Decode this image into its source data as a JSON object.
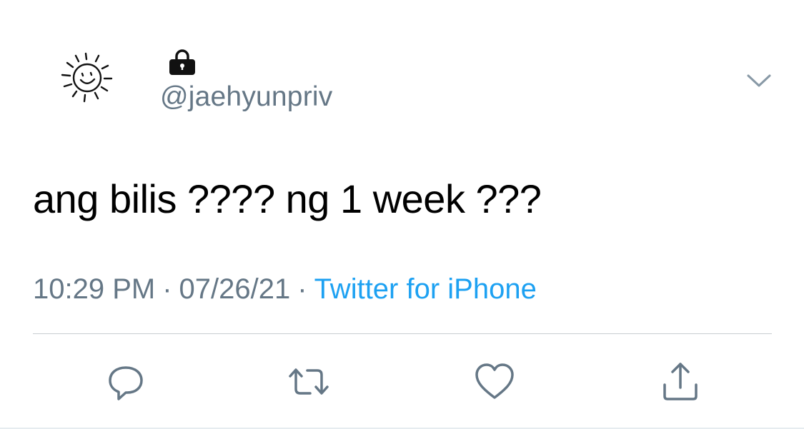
{
  "user": {
    "handle": "@jaehyunpriv",
    "protected": true,
    "avatar_icon": "smiling-sun-icon",
    "lock_icon": "lock-icon"
  },
  "tweet": {
    "text": "ang bilis ???? ng 1 week ???",
    "time": "10:29 PM",
    "separator": "·",
    "date": "07/26/21",
    "source": "Twitter for iPhone"
  },
  "actions": [
    {
      "icon": "reply-icon"
    },
    {
      "icon": "retweet-icon"
    },
    {
      "icon": "like-icon"
    },
    {
      "icon": "share-icon"
    }
  ],
  "colors": {
    "text": "#000000",
    "secondary": "#657786",
    "link": "#1da1f2",
    "divider": "#c8cdd1"
  }
}
